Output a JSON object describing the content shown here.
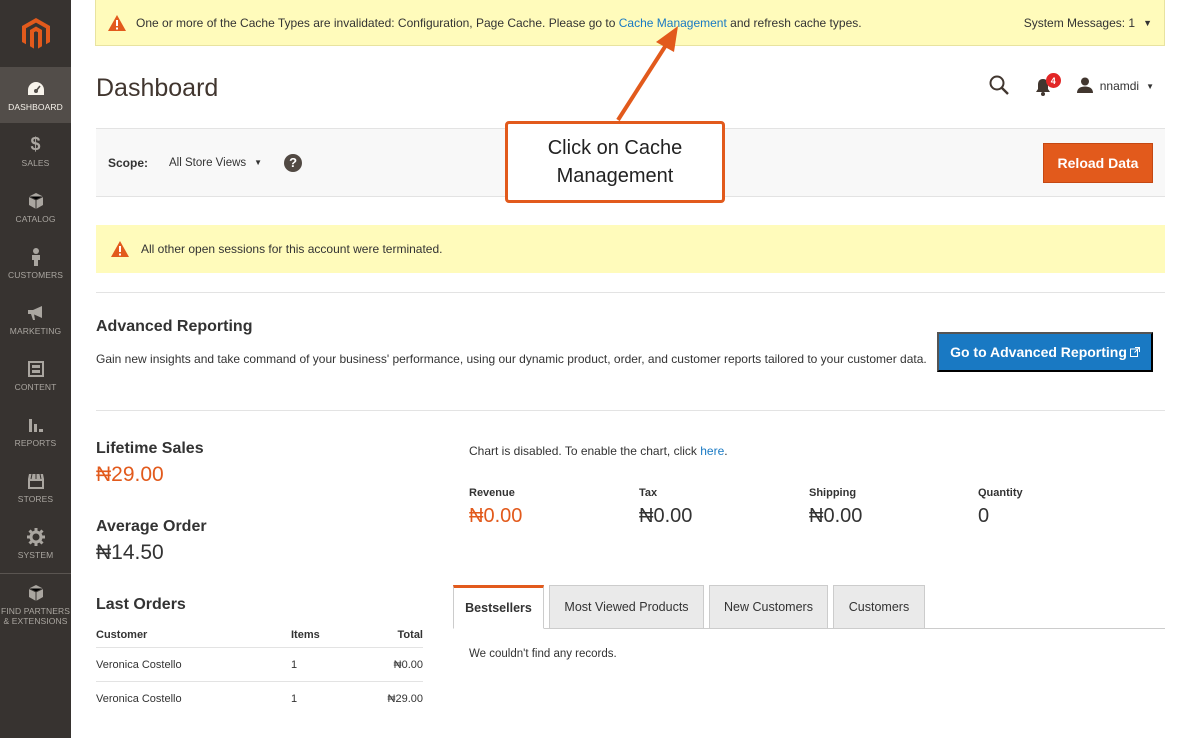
{
  "sidebar": {
    "items": [
      {
        "label": "Dashboard",
        "icon": "gauge-icon"
      },
      {
        "label": "Sales",
        "icon": "dollar-icon"
      },
      {
        "label": "Catalog",
        "icon": "box-icon"
      },
      {
        "label": "Customers",
        "icon": "person-icon"
      },
      {
        "label": "Marketing",
        "icon": "megaphone-icon"
      },
      {
        "label": "Content",
        "icon": "content-icon"
      },
      {
        "label": "Reports",
        "icon": "bar-chart-icon"
      },
      {
        "label": "Stores",
        "icon": "store-icon"
      },
      {
        "label": "System",
        "icon": "gear-icon"
      },
      {
        "label": "Find Partners & Extensions",
        "icon": "extensions-icon"
      }
    ]
  },
  "system_message": {
    "text_before": "One or more of the Cache Types are invalidated: Configuration, Page Cache. Please go to ",
    "link": "Cache Management",
    "text_after": " and refresh cache types.",
    "messages_label": "System Messages: 1"
  },
  "header": {
    "title": "Dashboard",
    "notifications_count": "4",
    "username": "nnamdi"
  },
  "scope": {
    "label": "Scope:",
    "value": "All Store Views",
    "help": "?",
    "reload_label": "Reload Data"
  },
  "callout": {
    "line1": "Click on Cache",
    "line2": "Management"
  },
  "session_message": "All other open sessions for this account were terminated.",
  "advanced_reporting": {
    "title": "Advanced Reporting",
    "description": "Gain new insights and take command of your business' performance, using our dynamic product, order, and customer reports tailored to your customer data.",
    "button_label": "Go to Advanced Reporting"
  },
  "stats": {
    "lifetime_sales_label": "Lifetime Sales",
    "lifetime_sales_value": "₦29.00",
    "average_order_label": "Average Order",
    "average_order_value": "₦14.50",
    "last_orders_label": "Last Orders"
  },
  "orders": {
    "columns": [
      "Customer",
      "Items",
      "Total"
    ],
    "rows": [
      {
        "customer": "Veronica Costello",
        "items": "1",
        "total": "₦0.00"
      },
      {
        "customer": "Veronica Costello",
        "items": "1",
        "total": "₦29.00"
      }
    ]
  },
  "chart_panel": {
    "disabled_text": "Chart is disabled. To enable the chart, click ",
    "here_link": "here",
    "period": ".",
    "metrics": [
      {
        "label": "Revenue",
        "value": "₦0.00"
      },
      {
        "label": "Tax",
        "value": "₦0.00"
      },
      {
        "label": "Shipping",
        "value": "₦0.00"
      },
      {
        "label": "Quantity",
        "value": "0"
      }
    ]
  },
  "tabs": {
    "items": [
      "Bestsellers",
      "Most Viewed Products",
      "New Customers",
      "Customers"
    ],
    "active": "Bestsellers",
    "empty_text": "We couldn't find any records."
  },
  "colors": {
    "accent": "#e25a1c",
    "link": "#1979c3",
    "sidebar": "#373330",
    "message_bg": "#fffbbb"
  }
}
